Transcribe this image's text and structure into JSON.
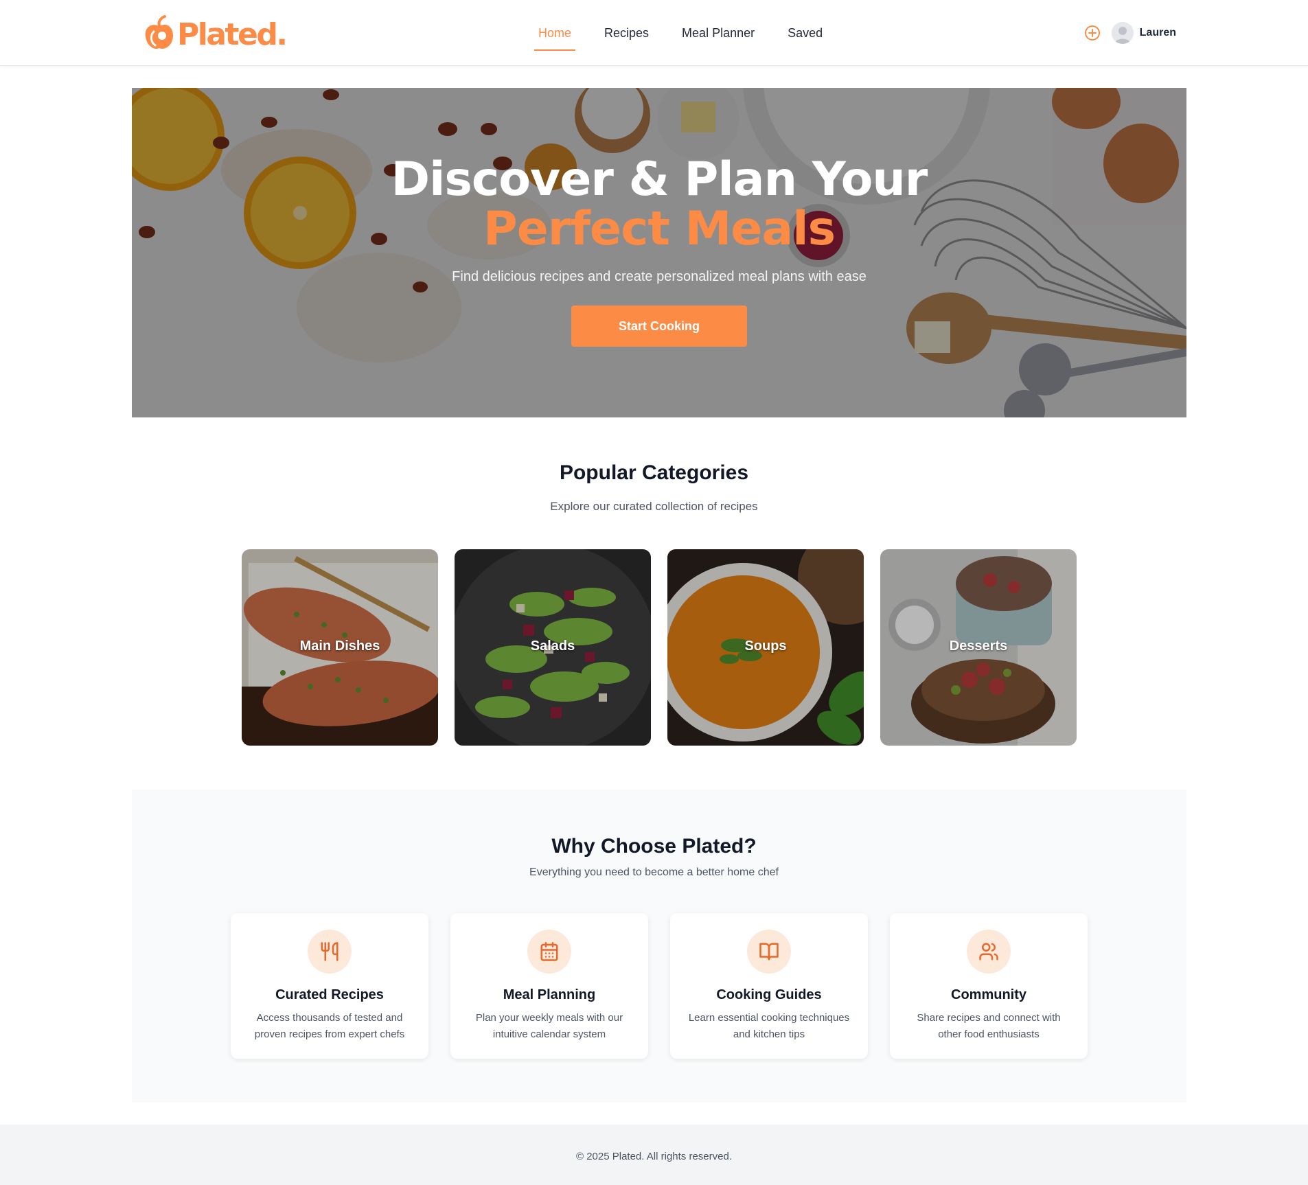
{
  "brand": {
    "name": "Plated.",
    "color": "#fb8b45"
  },
  "nav": {
    "items": [
      {
        "label": "Home",
        "active": true
      },
      {
        "label": "Recipes",
        "active": false
      },
      {
        "label": "Meal Planner",
        "active": false
      },
      {
        "label": "Saved",
        "active": false
      }
    ]
  },
  "user": {
    "name": "Lauren",
    "add_icon": "plus-circle-icon",
    "avatar_icon": "user-avatar-icon"
  },
  "hero": {
    "title_line1": "Discover & Plan Your",
    "title_line2": "Perfect Meals",
    "subtitle": "Find delicious recipes and create personalized meal plans with ease",
    "cta_label": "Start Cooking"
  },
  "categories": {
    "title": "Popular Categories",
    "subtitle": "Explore our curated collection of recipes",
    "items": [
      {
        "label": "Main Dishes"
      },
      {
        "label": "Salads"
      },
      {
        "label": "Soups"
      },
      {
        "label": "Desserts"
      }
    ]
  },
  "features": {
    "title": "Why Choose Plated?",
    "subtitle": "Everything you need to become a better home chef",
    "items": [
      {
        "icon": "utensils-icon",
        "title": "Curated Recipes",
        "description": "Access thousands of tested and proven recipes from expert chefs"
      },
      {
        "icon": "calendar-icon",
        "title": "Meal Planning",
        "description": "Plan your weekly meals with our intuitive calendar system"
      },
      {
        "icon": "book-open-icon",
        "title": "Cooking Guides",
        "description": "Learn essential cooking techniques and kitchen tips"
      },
      {
        "icon": "users-icon",
        "title": "Community",
        "description": "Share recipes and connect with other food enthusiasts"
      }
    ]
  },
  "footer": {
    "copyright": "© 2025 Plated. All rights reserved."
  }
}
